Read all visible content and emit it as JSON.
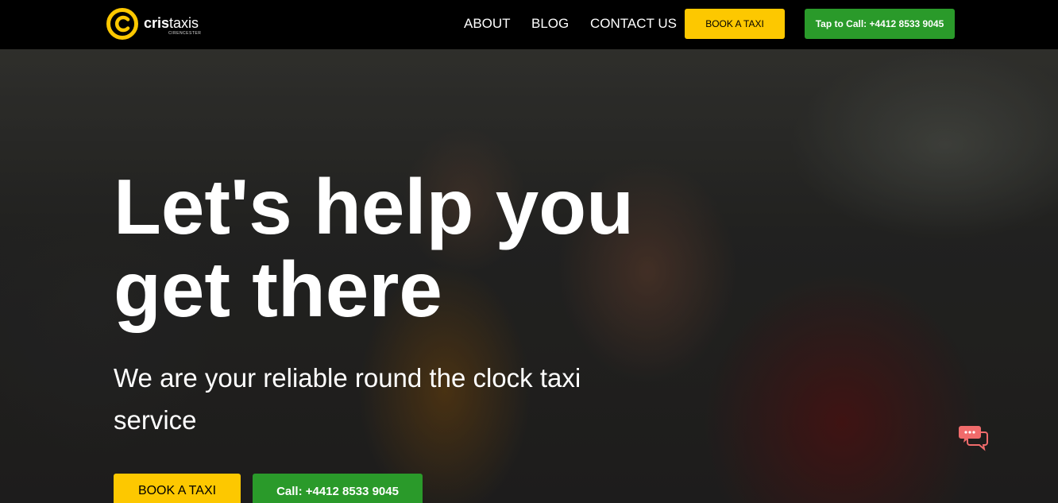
{
  "brand": {
    "name_bold": "cris",
    "name_light": "taxis",
    "location": "CIRENCESTER",
    "logo_icon": "c-letter-logo-icon",
    "accent_color": "#fdc800"
  },
  "nav": {
    "links": [
      {
        "label": "ABOUT"
      },
      {
        "label": "BLOG"
      },
      {
        "label": "CONTACT US"
      }
    ],
    "book_label": "BOOK A TAXI",
    "call_label": "Tap to Call: +4412 8533 9045"
  },
  "hero": {
    "title": "Let's help you get there",
    "subtitle": "We are your reliable round the clock taxi service",
    "book_label": "BOOK A TAXI",
    "call_label": "Call: +4412 8533 9045"
  },
  "chat": {
    "icon": "chat-bubble-icon",
    "color": "#f06b6b"
  },
  "colors": {
    "yellow": "#fdc800",
    "green": "#2a9a2a",
    "navbar": "#000000"
  }
}
